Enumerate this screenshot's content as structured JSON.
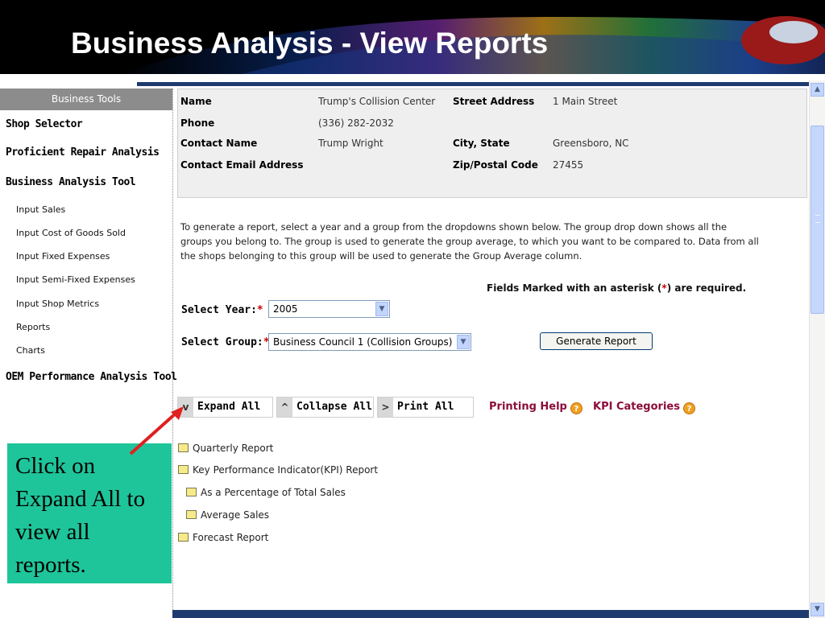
{
  "slide": {
    "title": "Business Analysis - View Reports"
  },
  "sidebar": {
    "header": "Business Tools",
    "items": [
      {
        "label": "Shop Selector",
        "type": "main"
      },
      {
        "label": "Proficient Repair Analysis",
        "type": "main"
      },
      {
        "label": "Business Analysis Tool",
        "type": "main"
      },
      {
        "label": "Input Sales",
        "type": "sub"
      },
      {
        "label": "Input Cost of Goods Sold",
        "type": "sub"
      },
      {
        "label": "Input Fixed Expenses",
        "type": "sub"
      },
      {
        "label": "Input Semi-Fixed Expenses",
        "type": "sub"
      },
      {
        "label": "Input Shop Metrics",
        "type": "sub"
      },
      {
        "label": "Reports",
        "type": "sub"
      },
      {
        "label": "Charts",
        "type": "sub"
      },
      {
        "label": "OEM Performance Analysis Tool",
        "type": "main"
      }
    ]
  },
  "shop_info": {
    "name_label": "Name",
    "name_value": "Trump's Collision Center",
    "street_label": "Street Address",
    "street_value": "1 Main Street",
    "phone_label": "Phone",
    "phone_value": "(336) 282-2032",
    "contact_label": "Contact Name",
    "contact_value": "Trump Wright",
    "city_label": "City, State",
    "city_value": "Greensboro, NC",
    "email_label": "Contact Email Address",
    "zip_label": "Zip/Postal Code",
    "zip_value": "27455"
  },
  "instructions": "To generate a report, select a year and a group from the dropdowns shown below. The group drop down shows all the groups you belong to. The group is used to generate the group average, to which you want to be compared to. Data from all the shops belonging to this group will be used to generate the Group Average column.",
  "required_note": {
    "prefix": "Fields Marked with an asterisk (",
    "star": "*",
    "suffix": ") are required."
  },
  "form": {
    "year_label": "Select Year:",
    "year_value": "2005",
    "group_label": "Select Group:",
    "group_value": "Business Council 1 (Collision Groups)",
    "required_star": "*",
    "generate_button": "Generate Report"
  },
  "toolbar": {
    "expand_icon": "v",
    "expand_label": "Expand All",
    "collapse_icon": "^",
    "collapse_label": "Collapse All",
    "print_icon": ">",
    "print_label": "Print All",
    "printing_help": "Printing Help",
    "kpi_categories": "KPI Categories",
    "help_glyph": "?"
  },
  "tree": [
    {
      "label": "Quarterly Report",
      "level": 0
    },
    {
      "label": "Key Performance Indicator(KPI) Report",
      "level": 0
    },
    {
      "label": "As a Percentage of Total Sales",
      "level": 1
    },
    {
      "label": "Average Sales",
      "level": 1
    },
    {
      "label": "Forecast Report",
      "level": 0
    }
  ],
  "callout": {
    "text": "Click on Expand All to view all reports."
  },
  "colors": {
    "callout_bg": "#1fc59a",
    "link": "#8b0d3a",
    "required": "#cc0000",
    "header_bar": "#1f3a6e"
  },
  "icons": {
    "folder": "folder-icon",
    "help": "help-icon",
    "dropdown": "chevron-down-icon"
  }
}
